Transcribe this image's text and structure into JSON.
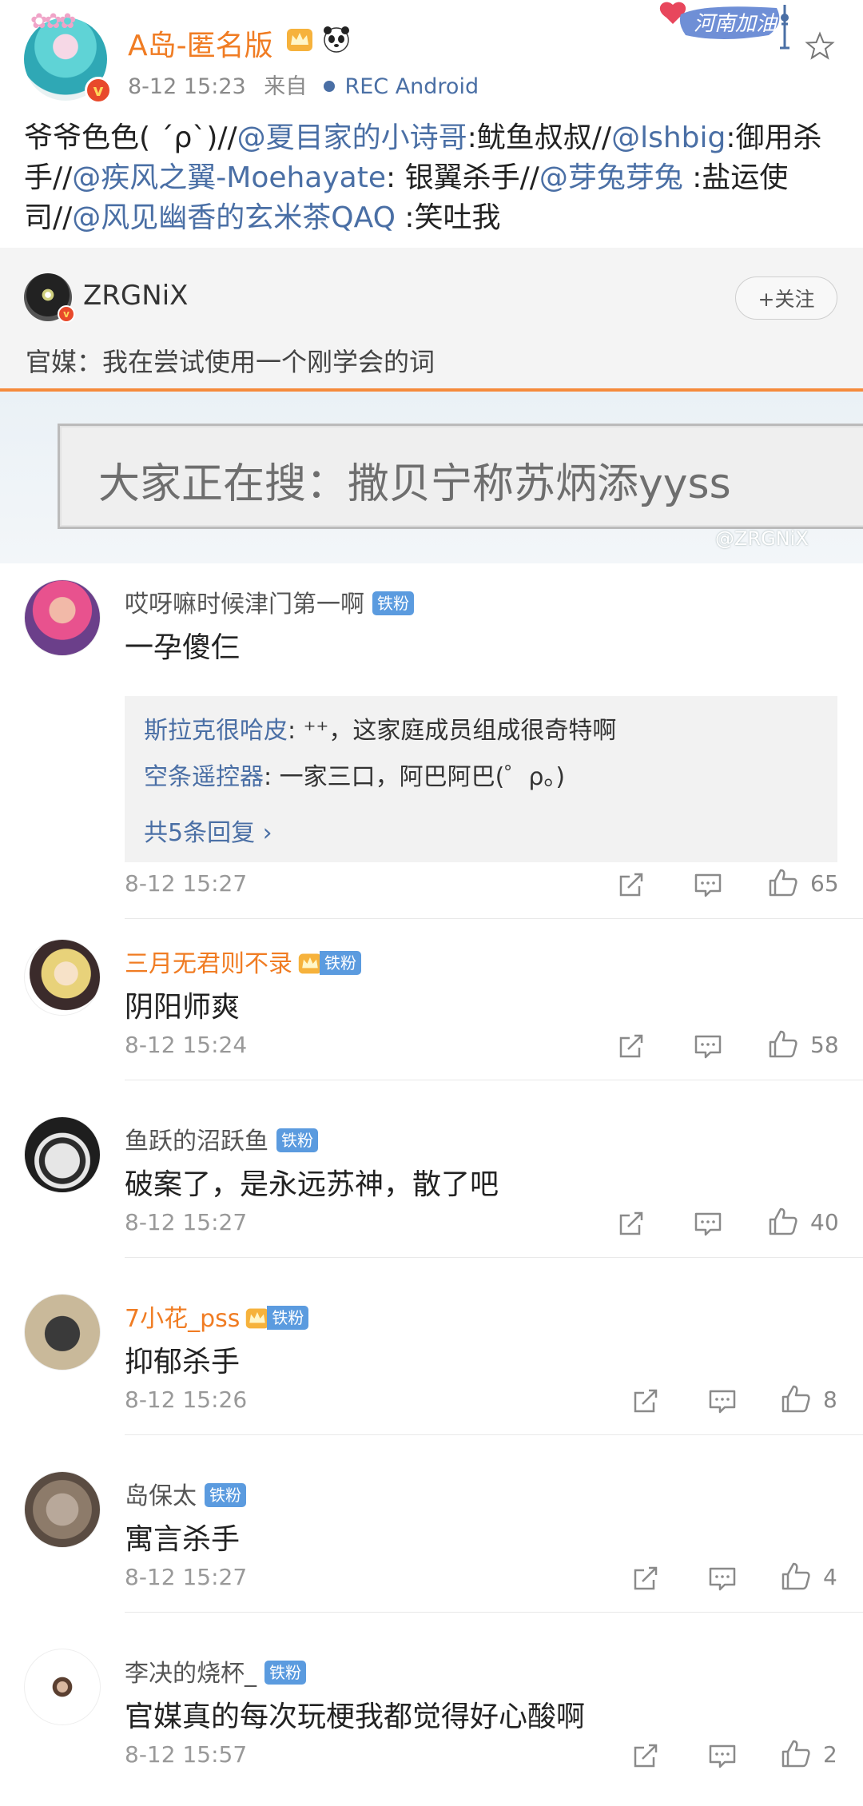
{
  "post": {
    "author": "A岛-匿名版",
    "time": "8-12 15:23",
    "from_label": "来自",
    "source": "REC  Android",
    "badge_text": "河南加油",
    "text_parts": [
      {
        "t": "爷爷色色( ´ρ`)//",
        "m": false
      },
      {
        "t": "@夏目家的小诗哥",
        "m": true
      },
      {
        "t": ":鱿鱼叔叔//",
        "m": false
      },
      {
        "t": "@lshbig",
        "m": true
      },
      {
        "t": ":御用杀手//",
        "m": false
      },
      {
        "t": "@疾风之翼-Moehayate",
        "m": true
      },
      {
        "t": ": 银翼杀手//",
        "m": false
      },
      {
        "t": "@芽兔芽兔",
        "m": true
      },
      {
        "t": " :盐运使司//",
        "m": false
      },
      {
        "t": "@风见幽香的玄米茶QAQ",
        "m": true
      },
      {
        "t": " :笑吐我",
        "m": false
      }
    ]
  },
  "repost": {
    "author": "ZRGNiX",
    "follow_label": "+关注",
    "text": "官媒：我在尝试使用一个刚学会的词",
    "embed_text": "大家正在搜：撒贝宁称苏炳添yyss",
    "watermark": "@ZRGNiX"
  },
  "comments": [
    {
      "name": "哎呀嘛时候津门第一啊",
      "vip": false,
      "fan": "铁粉",
      "text": "一孕傻仨",
      "time": "8-12 15:27",
      "likes": "65",
      "replies": [
        {
          "name": "斯拉克很哈皮",
          "text": ": ⁺⁺，这家庭成员组成很奇特啊"
        },
        {
          "name": "空条遥控器",
          "text": ": 一家三口，阿巴阿巴(゜ρ。)"
        }
      ],
      "more": "共5条回复 ›"
    },
    {
      "name": "三月无君则不录",
      "vip": true,
      "fan": "铁粉",
      "text": "阴阳师爽",
      "time": "8-12 15:24",
      "likes": "58"
    },
    {
      "name": "鱼跃的沼跃鱼",
      "vip": false,
      "fan": "铁粉",
      "text": "破案了，是永远苏神，散了吧",
      "time": "8-12 15:27",
      "likes": "40"
    },
    {
      "name": "7小花_pss",
      "vip": true,
      "fan": "铁粉",
      "text": "抑郁杀手",
      "time": "8-12 15:26",
      "likes": "8"
    },
    {
      "name": "岛保太",
      "vip": false,
      "fan": "铁粉",
      "text": "寓言杀手",
      "time": "8-12 15:27",
      "likes": "4"
    },
    {
      "name": "李决的烧杯_",
      "vip": false,
      "fan": "铁粉",
      "text": "官媒真的每次玩梗我都觉得好心酸啊",
      "time": "8-12 15:57",
      "likes": "2"
    }
  ],
  "colors": {
    "mention": "#4a6fa5",
    "vip_name": "#f07c23",
    "fan_badge": "#5b9bdf",
    "accent_line": "#f58a3c"
  }
}
